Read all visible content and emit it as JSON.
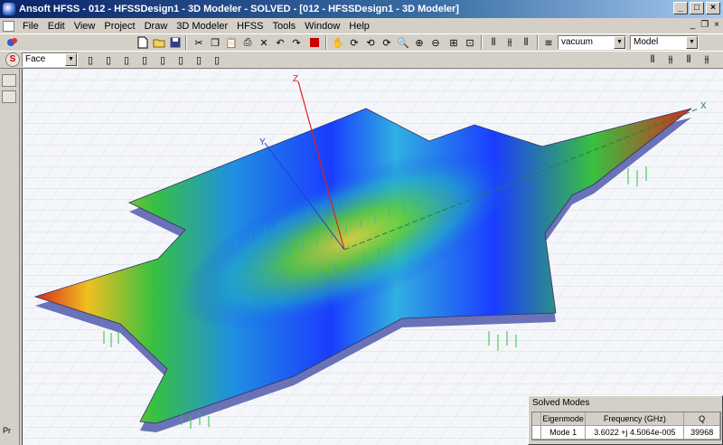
{
  "window": {
    "title": "Ansoft HFSS - 012 - HFSSDesign1 - 3D Modeler - SOLVED - [012 - HFSSDesign1 - 3D Modeler]"
  },
  "menu": [
    "File",
    "Edit",
    "View",
    "Project",
    "Draw",
    "3D Modeler",
    "HFSS",
    "Tools",
    "Window",
    "Help"
  ],
  "toolbar": {
    "material_value": "vacuum",
    "model_value": "Model",
    "select_mode_value": "Face"
  },
  "axes": {
    "z": "Z",
    "y": "Y",
    "x": "X"
  },
  "left_panel": {
    "pr_label": "Pr"
  },
  "solved_modes": {
    "title": "Solved Modes",
    "columns": [
      "",
      "Eigenmode",
      "Frequency (GHz)",
      "Q"
    ],
    "rows": [
      [
        "",
        "Mode 1",
        "3.6022 +j 4.5064e-005",
        "39968"
      ]
    ]
  },
  "colors": {
    "title_bar": "#0a246a",
    "field_high": "#d62a1e",
    "field_low": "#1a3cff"
  }
}
